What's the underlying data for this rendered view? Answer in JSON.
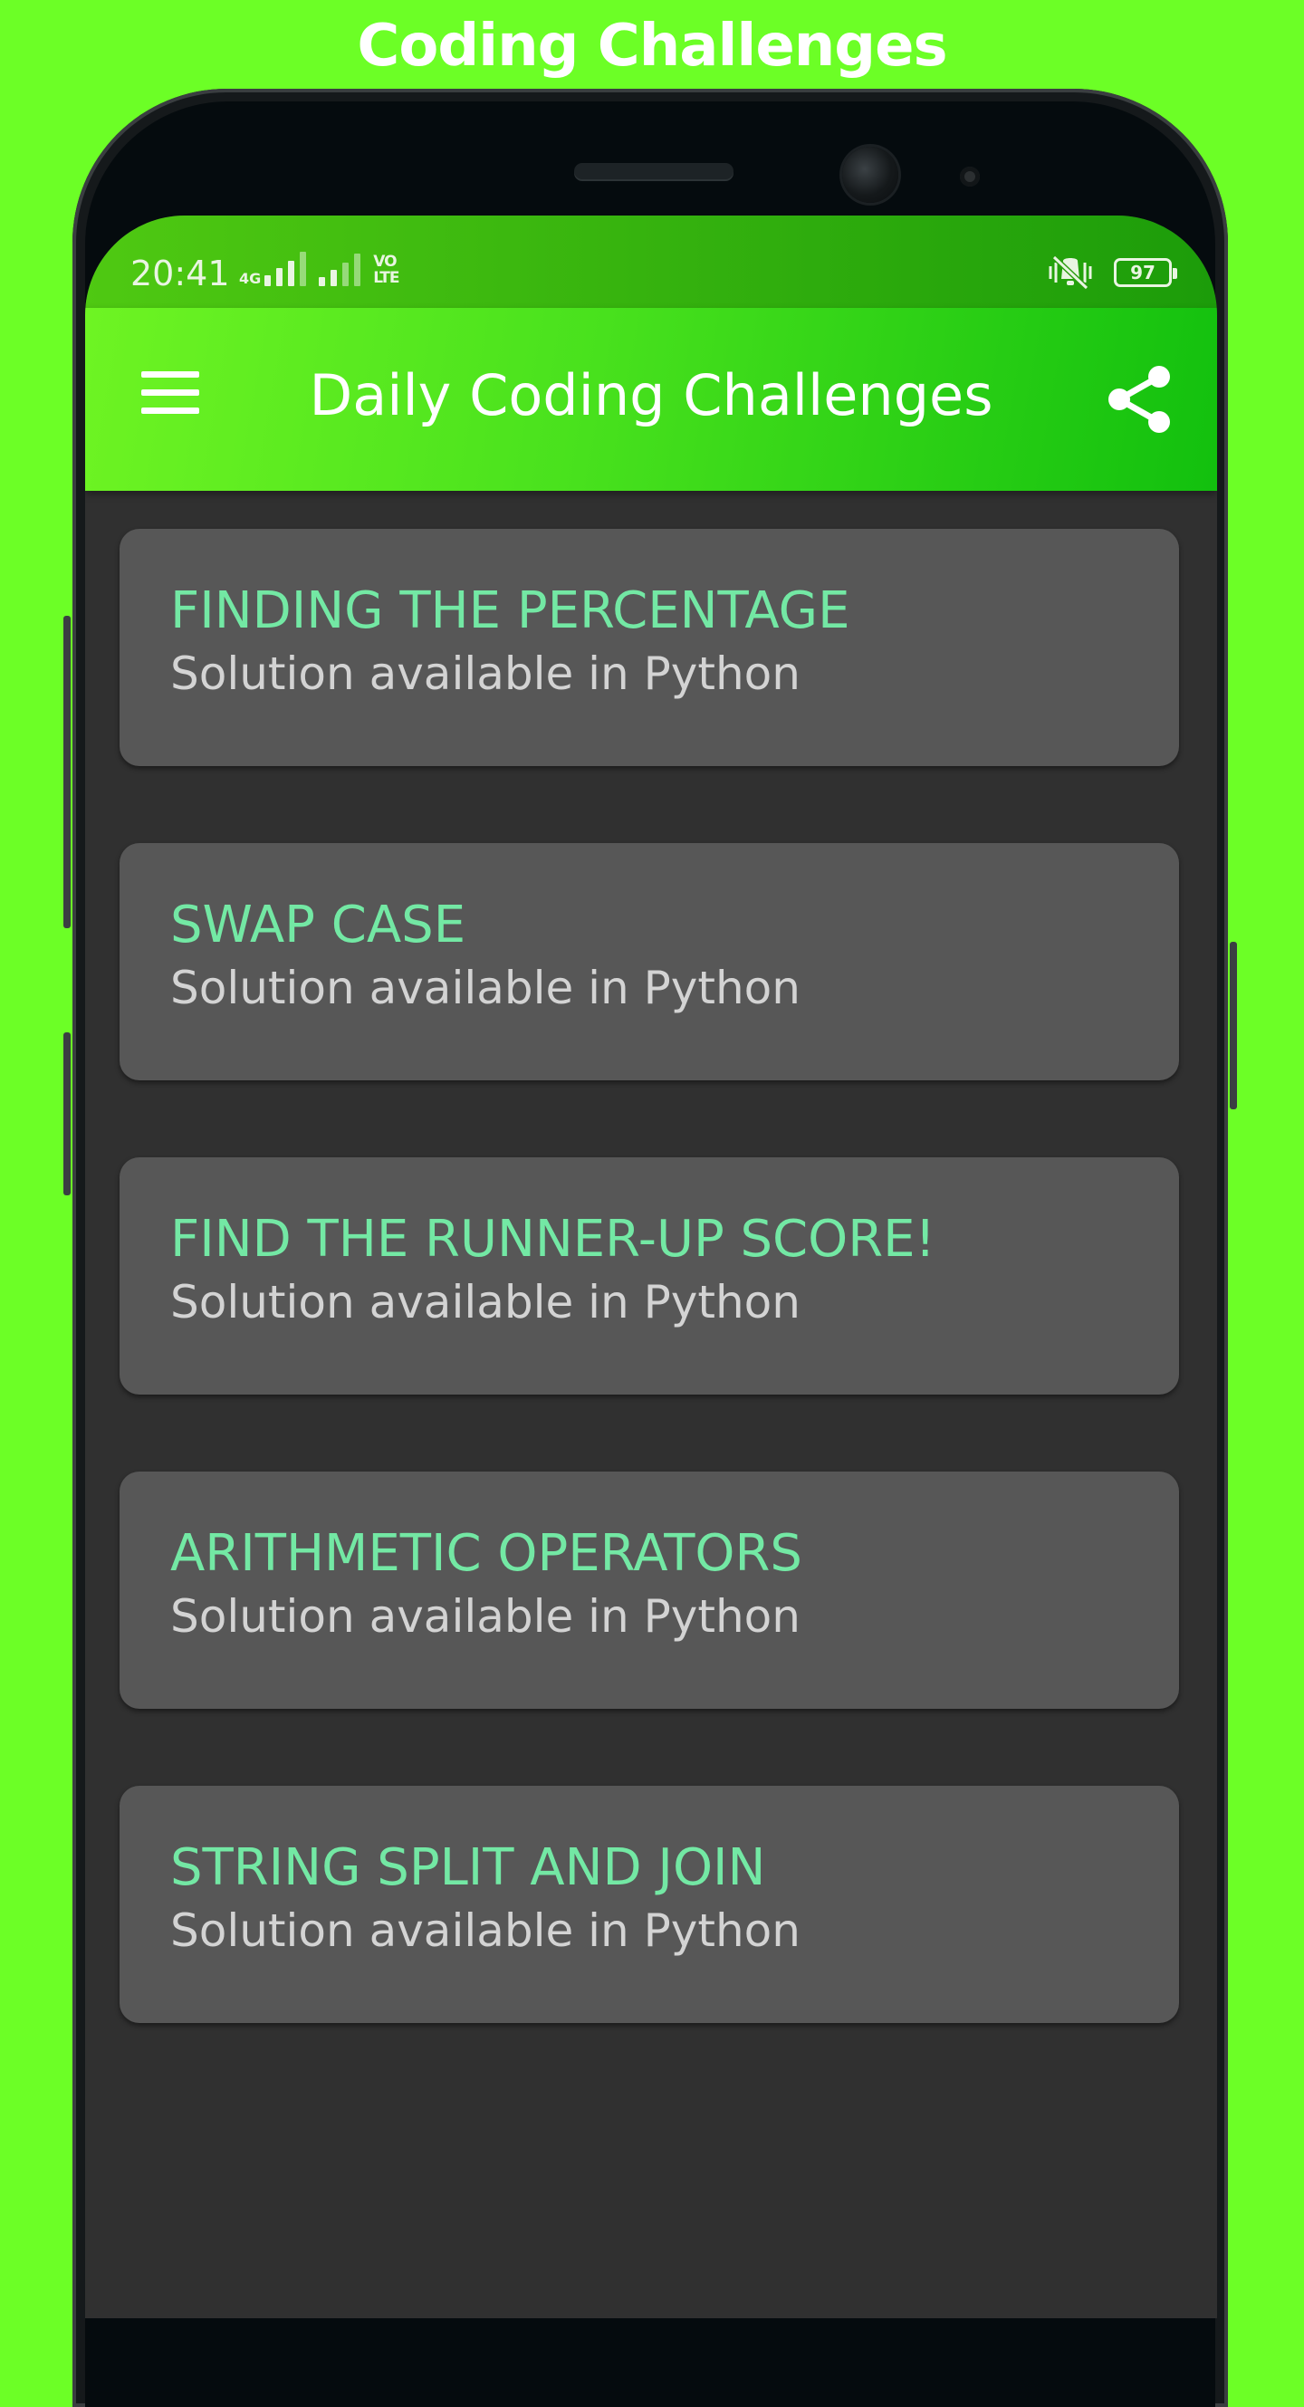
{
  "banner": {
    "title": "Coding Challenges"
  },
  "statusbar": {
    "time": "20:41",
    "network_label": "4G",
    "volte_label": "VO LTE",
    "battery": "97"
  },
  "appbar": {
    "title": "Daily Coding Challenges",
    "menu_icon": "hamburger-menu-icon",
    "share_icon": "share-icon"
  },
  "challenges": [
    {
      "title": "FINDING THE PERCENTAGE",
      "subtitle": "Solution available in Python"
    },
    {
      "title": "SWAP CASE",
      "subtitle": "Solution available in Python"
    },
    {
      "title": "FIND THE RUNNER-UP SCORE!",
      "subtitle": "Solution available in Python"
    },
    {
      "title": "ARITHMETIC OPERATORS",
      "subtitle": "Solution available in Python"
    },
    {
      "title": "STRING SPLIT AND JOIN",
      "subtitle": "Solution available in Python"
    }
  ],
  "colors": {
    "background": "#6cff26",
    "card": "#575757",
    "card_title": "#73e8a4",
    "card_subtitle": "#d3d3d3",
    "screen": "#303030"
  }
}
